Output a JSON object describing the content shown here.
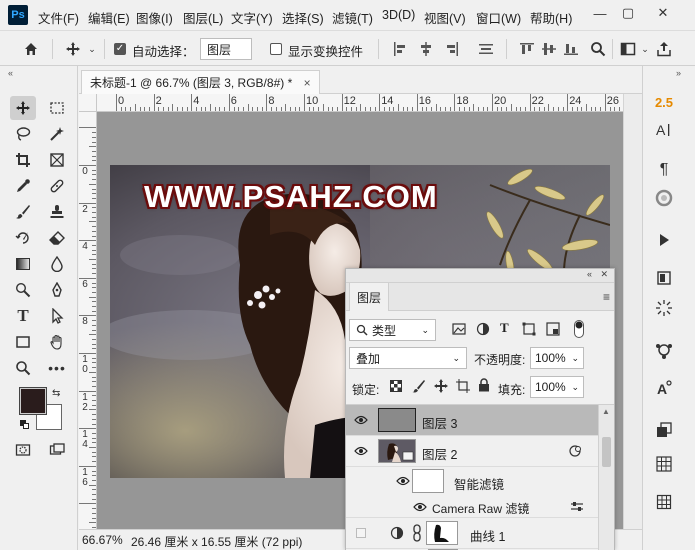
{
  "menubar": {
    "logo": "Ps",
    "items": [
      "文件(F)",
      "编辑(E)",
      "图像(I)",
      "图层(L)",
      "文字(Y)",
      "选择(S)",
      "滤镜(T)",
      "3D(D)",
      "视图(V)",
      "窗口(W)",
      "帮助(H)"
    ],
    "window_controls": {
      "minimize": "—",
      "restore": "▢",
      "close": "✕"
    }
  },
  "optionsbar": {
    "auto_select_checked": true,
    "auto_select_label": "自动选择：",
    "auto_select_target": "图层",
    "show_transform_checked": false,
    "show_transform_label": "显示变换控件"
  },
  "document": {
    "tab_title": "未标题-1 @ 66.7% (图层 3, RGB/8#) *",
    "tab_close": "×",
    "watermark_text": "WWW.PSAHZ.COM"
  },
  "rulers": {
    "h_labels": [
      "0",
      "2",
      "4",
      "6",
      "8",
      "10",
      "12",
      "14",
      "16",
      "18",
      "20",
      "22",
      "24",
      "26"
    ],
    "v_labels": [
      "0",
      "2",
      "4",
      "6",
      "8",
      "1 0",
      "1 2",
      "1 4",
      "1 6"
    ]
  },
  "statusbar": {
    "zoom": "66.67%",
    "doc_info": "26.46 厘米 x 16.55 厘米 (72 ppi)"
  },
  "right_strip": {
    "version_badge": "2.5"
  },
  "layers_panel": {
    "tab_label": "图层",
    "filter_label": "类型",
    "blend_mode": "叠加",
    "opacity_label": "不透明度:",
    "opacity_value": "100%",
    "lock_label": "锁定:",
    "fill_label": "填充:",
    "fill_value": "100%",
    "layers": [
      {
        "name": "图层 3",
        "visible": true,
        "selected": true
      },
      {
        "name": "图层 2",
        "visible": true,
        "selected": false
      },
      {
        "name": "智能滤镜",
        "visible": true,
        "selected": false
      },
      {
        "name": "Camera Raw 滤镜",
        "visible": true,
        "selected": false
      },
      {
        "name": "曲线 1",
        "visible": false,
        "selected": false
      }
    ]
  },
  "colors": {
    "foreground": "#2a1c1c",
    "background": "#ffffff",
    "accent_orange": "#e68a00",
    "watermark_outline": "#6b0c0c"
  }
}
